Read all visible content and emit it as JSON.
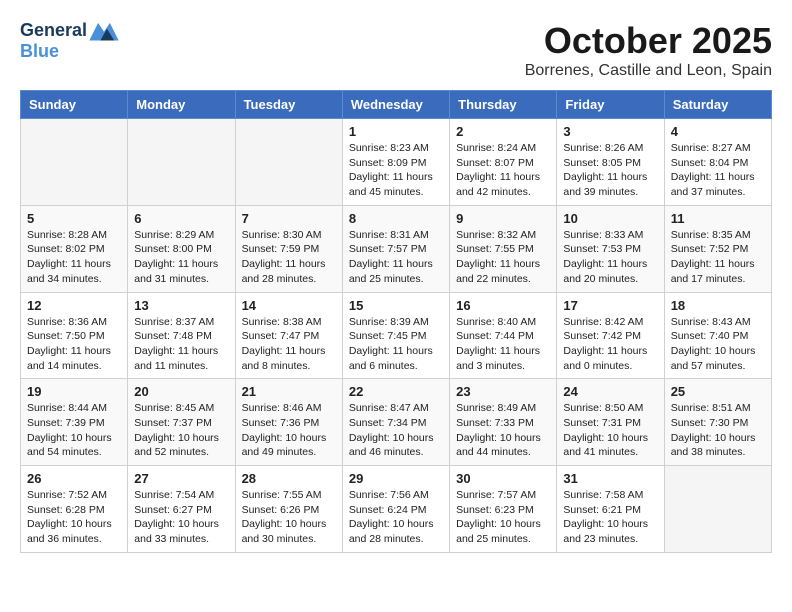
{
  "header": {
    "logo_line1": "General",
    "logo_line2": "Blue",
    "month": "October 2025",
    "location": "Borrenes, Castille and Leon, Spain"
  },
  "days_of_week": [
    "Sunday",
    "Monday",
    "Tuesday",
    "Wednesday",
    "Thursday",
    "Friday",
    "Saturday"
  ],
  "weeks": [
    [
      {
        "day": "",
        "info": ""
      },
      {
        "day": "",
        "info": ""
      },
      {
        "day": "",
        "info": ""
      },
      {
        "day": "1",
        "info": "Sunrise: 8:23 AM\nSunset: 8:09 PM\nDaylight: 11 hours and 45 minutes."
      },
      {
        "day": "2",
        "info": "Sunrise: 8:24 AM\nSunset: 8:07 PM\nDaylight: 11 hours and 42 minutes."
      },
      {
        "day": "3",
        "info": "Sunrise: 8:26 AM\nSunset: 8:05 PM\nDaylight: 11 hours and 39 minutes."
      },
      {
        "day": "4",
        "info": "Sunrise: 8:27 AM\nSunset: 8:04 PM\nDaylight: 11 hours and 37 minutes."
      }
    ],
    [
      {
        "day": "5",
        "info": "Sunrise: 8:28 AM\nSunset: 8:02 PM\nDaylight: 11 hours and 34 minutes."
      },
      {
        "day": "6",
        "info": "Sunrise: 8:29 AM\nSunset: 8:00 PM\nDaylight: 11 hours and 31 minutes."
      },
      {
        "day": "7",
        "info": "Sunrise: 8:30 AM\nSunset: 7:59 PM\nDaylight: 11 hours and 28 minutes."
      },
      {
        "day": "8",
        "info": "Sunrise: 8:31 AM\nSunset: 7:57 PM\nDaylight: 11 hours and 25 minutes."
      },
      {
        "day": "9",
        "info": "Sunrise: 8:32 AM\nSunset: 7:55 PM\nDaylight: 11 hours and 22 minutes."
      },
      {
        "day": "10",
        "info": "Sunrise: 8:33 AM\nSunset: 7:53 PM\nDaylight: 11 hours and 20 minutes."
      },
      {
        "day": "11",
        "info": "Sunrise: 8:35 AM\nSunset: 7:52 PM\nDaylight: 11 hours and 17 minutes."
      }
    ],
    [
      {
        "day": "12",
        "info": "Sunrise: 8:36 AM\nSunset: 7:50 PM\nDaylight: 11 hours and 14 minutes."
      },
      {
        "day": "13",
        "info": "Sunrise: 8:37 AM\nSunset: 7:48 PM\nDaylight: 11 hours and 11 minutes."
      },
      {
        "day": "14",
        "info": "Sunrise: 8:38 AM\nSunset: 7:47 PM\nDaylight: 11 hours and 8 minutes."
      },
      {
        "day": "15",
        "info": "Sunrise: 8:39 AM\nSunset: 7:45 PM\nDaylight: 11 hours and 6 minutes."
      },
      {
        "day": "16",
        "info": "Sunrise: 8:40 AM\nSunset: 7:44 PM\nDaylight: 11 hours and 3 minutes."
      },
      {
        "day": "17",
        "info": "Sunrise: 8:42 AM\nSunset: 7:42 PM\nDaylight: 11 hours and 0 minutes."
      },
      {
        "day": "18",
        "info": "Sunrise: 8:43 AM\nSunset: 7:40 PM\nDaylight: 10 hours and 57 minutes."
      }
    ],
    [
      {
        "day": "19",
        "info": "Sunrise: 8:44 AM\nSunset: 7:39 PM\nDaylight: 10 hours and 54 minutes."
      },
      {
        "day": "20",
        "info": "Sunrise: 8:45 AM\nSunset: 7:37 PM\nDaylight: 10 hours and 52 minutes."
      },
      {
        "day": "21",
        "info": "Sunrise: 8:46 AM\nSunset: 7:36 PM\nDaylight: 10 hours and 49 minutes."
      },
      {
        "day": "22",
        "info": "Sunrise: 8:47 AM\nSunset: 7:34 PM\nDaylight: 10 hours and 46 minutes."
      },
      {
        "day": "23",
        "info": "Sunrise: 8:49 AM\nSunset: 7:33 PM\nDaylight: 10 hours and 44 minutes."
      },
      {
        "day": "24",
        "info": "Sunrise: 8:50 AM\nSunset: 7:31 PM\nDaylight: 10 hours and 41 minutes."
      },
      {
        "day": "25",
        "info": "Sunrise: 8:51 AM\nSunset: 7:30 PM\nDaylight: 10 hours and 38 minutes."
      }
    ],
    [
      {
        "day": "26",
        "info": "Sunrise: 7:52 AM\nSunset: 6:28 PM\nDaylight: 10 hours and 36 minutes."
      },
      {
        "day": "27",
        "info": "Sunrise: 7:54 AM\nSunset: 6:27 PM\nDaylight: 10 hours and 33 minutes."
      },
      {
        "day": "28",
        "info": "Sunrise: 7:55 AM\nSunset: 6:26 PM\nDaylight: 10 hours and 30 minutes."
      },
      {
        "day": "29",
        "info": "Sunrise: 7:56 AM\nSunset: 6:24 PM\nDaylight: 10 hours and 28 minutes."
      },
      {
        "day": "30",
        "info": "Sunrise: 7:57 AM\nSunset: 6:23 PM\nDaylight: 10 hours and 25 minutes."
      },
      {
        "day": "31",
        "info": "Sunrise: 7:58 AM\nSunset: 6:21 PM\nDaylight: 10 hours and 23 minutes."
      },
      {
        "day": "",
        "info": ""
      }
    ]
  ]
}
